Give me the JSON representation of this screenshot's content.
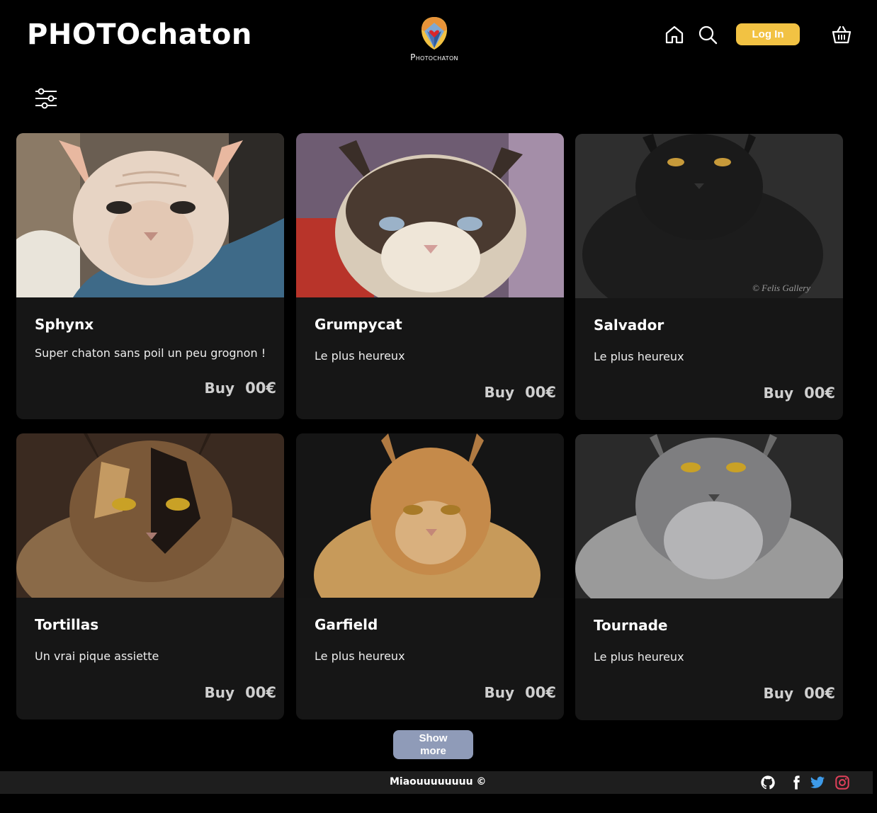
{
  "header": {
    "brand": "PHOTOchaton",
    "logo_text": "Photochaton",
    "login_label": "Log In"
  },
  "cards": [
    {
      "title": "Sphynx",
      "description": "Super chaton sans poil un peu grognon !",
      "buy_label": "Buy",
      "price": "00€"
    },
    {
      "title": "Grumpycat",
      "description": "Le plus heureux",
      "buy_label": "Buy",
      "price": "00€"
    },
    {
      "title": "Salvador",
      "description": "Le plus heureux",
      "buy_label": "Buy",
      "price": "00€"
    },
    {
      "title": "Tortillas",
      "description": "Un vrai pique assiette",
      "buy_label": "Buy",
      "price": "00€"
    },
    {
      "title": "Garfield",
      "description": "Le plus heureux",
      "buy_label": "Buy",
      "price": "00€"
    },
    {
      "title": "Tournade",
      "description": "Le plus heureux",
      "buy_label": "Buy",
      "price": "00€"
    }
  ],
  "show_more_label": "Show more",
  "footer": {
    "text": "Miaouuuuuuuu ©",
    "social_icons": [
      "github-icon",
      "facebook-icon",
      "twitter-icon",
      "instagram-icon"
    ]
  },
  "colors": {
    "accent": "#f2c243",
    "show_more": "#8f9bb8",
    "card_bg": "#161616",
    "footer_bg": "#1e1e1e"
  }
}
